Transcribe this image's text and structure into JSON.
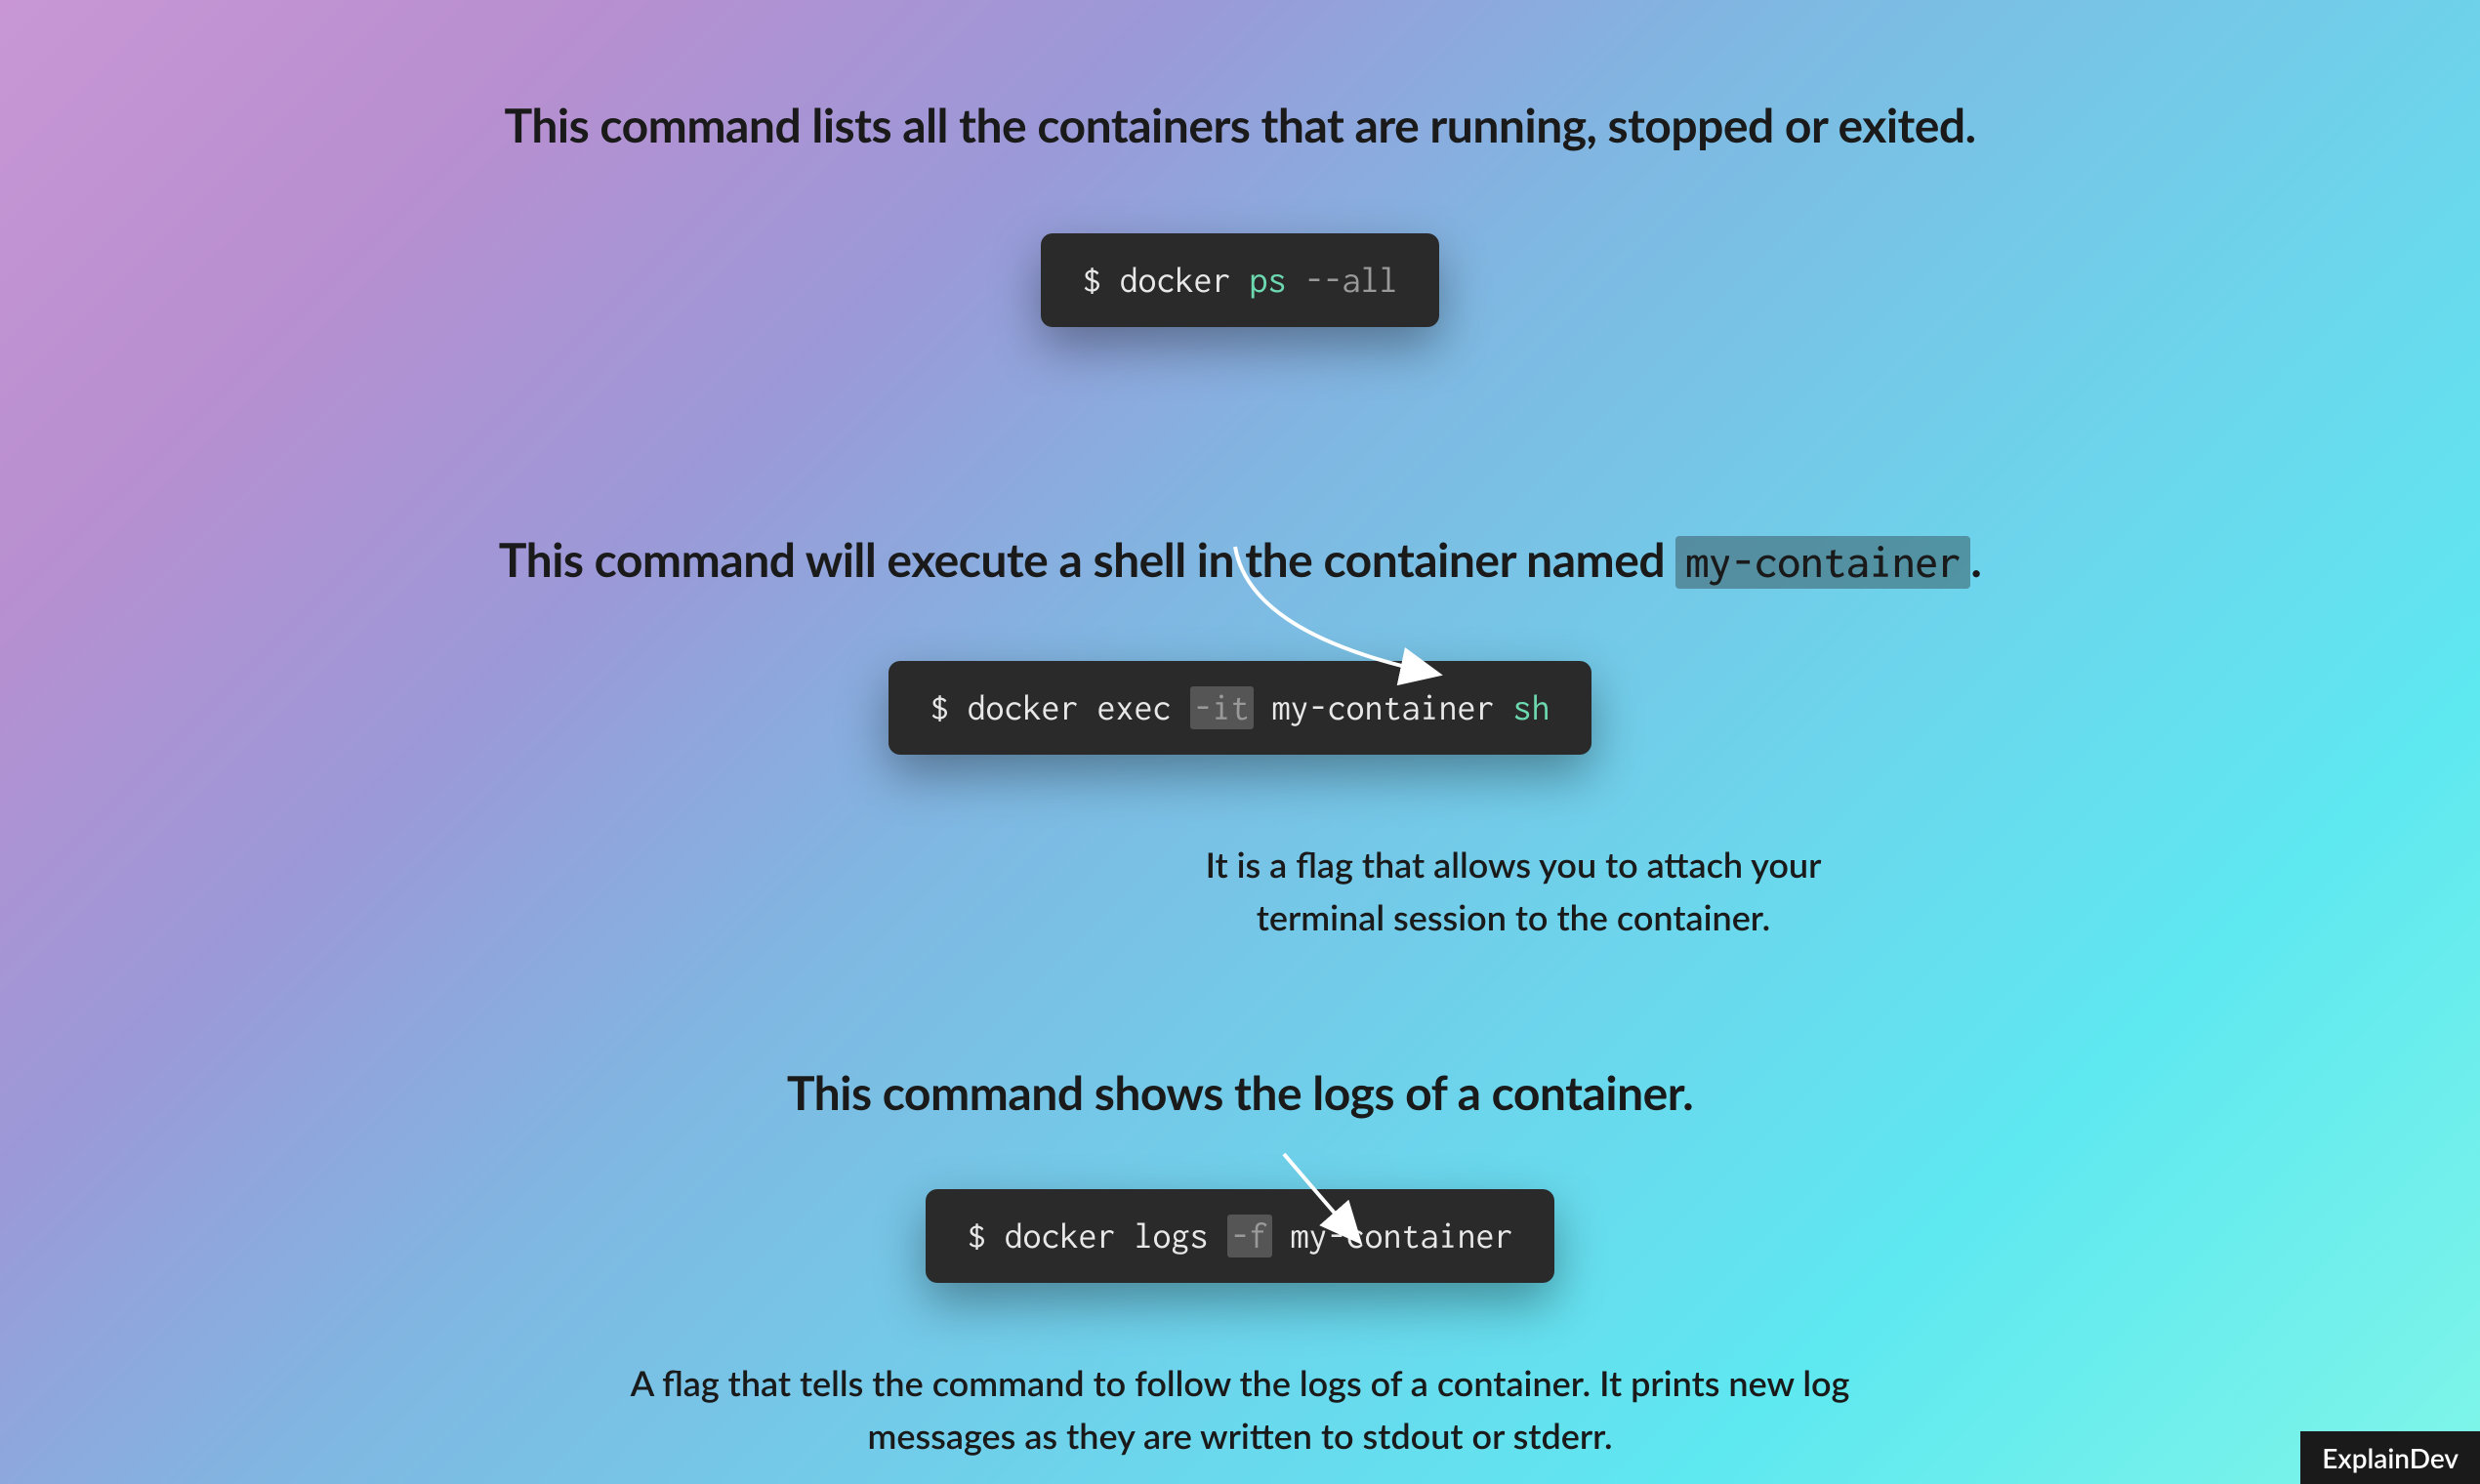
{
  "sections": [
    {
      "heading_pre": "This command lists all the containers that are running, stopped or exited.",
      "command": {
        "prompt": "$ ",
        "parts": [
          {
            "text": "docker ",
            "cls": "cmd-white"
          },
          {
            "text": "ps ",
            "cls": "cmd-green"
          },
          {
            "text": "--all",
            "cls": "cmd-gray"
          }
        ]
      }
    },
    {
      "heading_pre": "This command will execute a shell in the container named ",
      "heading_code": "my-container",
      "heading_post": ".",
      "command": {
        "prompt": "$ ",
        "parts": [
          {
            "text": "docker ",
            "cls": "cmd-white"
          },
          {
            "text": "exec ",
            "cls": "cmd-white"
          },
          {
            "text": "-it",
            "cls": "cmd-gray",
            "highlight": true
          },
          {
            "text": " my-container ",
            "cls": "cmd-white"
          },
          {
            "text": "sh",
            "cls": "cmd-green"
          }
        ]
      },
      "annotation": "It is a flag that allows you to attach your terminal session to the container."
    },
    {
      "heading_pre": "This command shows the logs of a container.",
      "command": {
        "prompt": "$ ",
        "parts": [
          {
            "text": "docker ",
            "cls": "cmd-white"
          },
          {
            "text": "logs ",
            "cls": "cmd-white"
          },
          {
            "text": "-f",
            "cls": "cmd-gray",
            "highlight": true
          },
          {
            "text": " my-container",
            "cls": "cmd-white"
          }
        ]
      },
      "annotation": "A flag that tells the command to follow the logs of a container. It prints new log messages as they are written to stdout or stderr."
    }
  ],
  "watermark": "ExplainDev"
}
